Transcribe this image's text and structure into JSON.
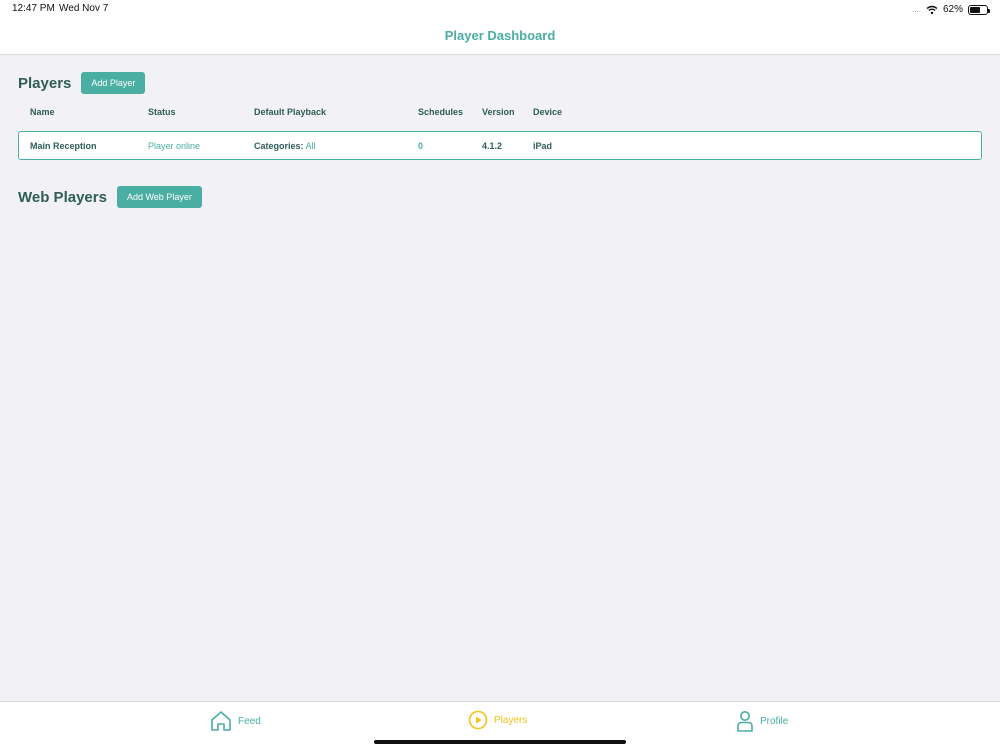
{
  "status_bar": {
    "time": "12:47 PM",
    "date": "Wed Nov 7",
    "battery": "62%",
    "battery_level": 0.62
  },
  "nav": {
    "title": "Player Dashboard"
  },
  "players_section": {
    "title": "Players",
    "add_button": "Add Player",
    "columns": {
      "name": "Name",
      "status": "Status",
      "playback": "Default Playback",
      "schedules": "Schedules",
      "version": "Version",
      "device": "Device"
    },
    "rows": [
      {
        "name": "Main Reception",
        "status": "Player online",
        "playback_label": "Categories:",
        "playback_value": "All",
        "schedules": "0",
        "version": "4.1.2",
        "device": "iPad"
      }
    ]
  },
  "web_players_section": {
    "title": "Web Players",
    "add_button": "Add Web Player"
  },
  "tabbar": {
    "feed": "Feed",
    "players": "Players",
    "profile": "Profile"
  },
  "colors": {
    "accent": "#4aaea3",
    "active_tab": "#f2c31a",
    "text_dark": "#2f5d57"
  },
  "icons": {
    "feed": "house-icon",
    "players": "play-circle-icon",
    "profile": "person-icon",
    "wifi": "wifi-icon",
    "battery": "battery-icon"
  }
}
